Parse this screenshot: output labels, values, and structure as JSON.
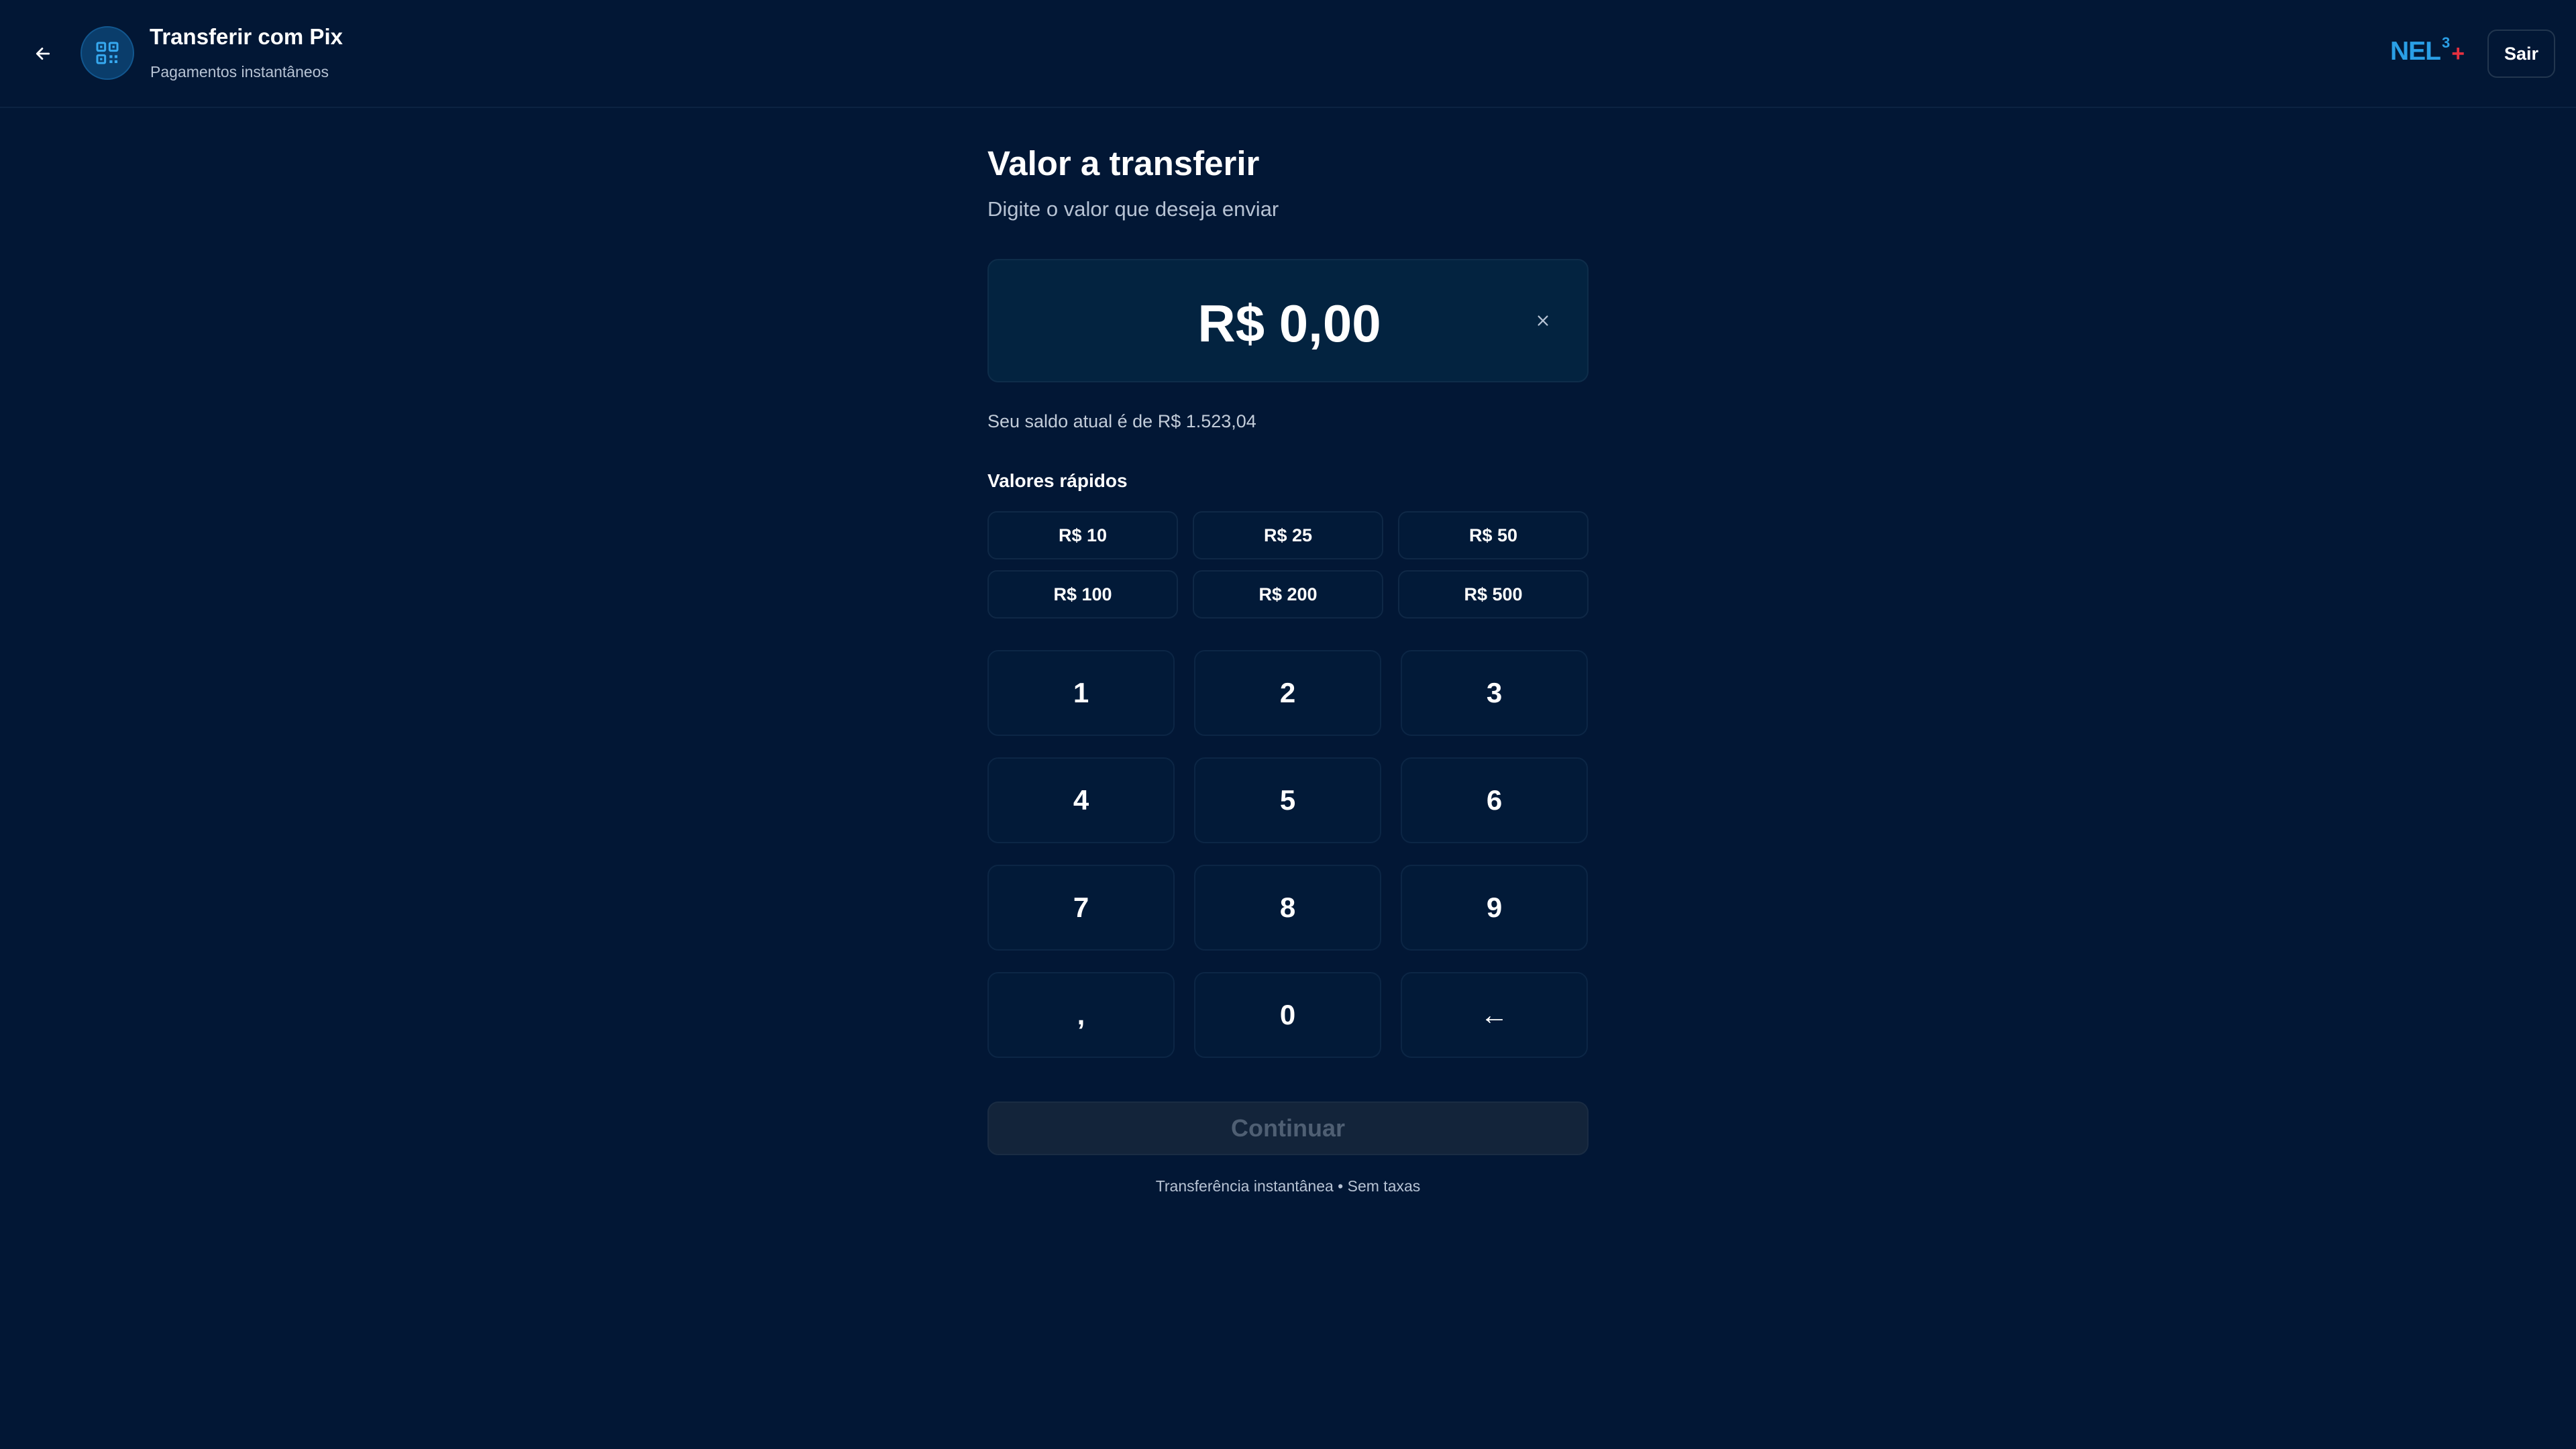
{
  "header": {
    "title": "Transferir com Pix",
    "subtitle": "Pagamentos instantâneos",
    "back_icon": "arrow-left-icon",
    "app_icon": "qr-code-icon",
    "brand": {
      "name": "NEL",
      "superscript": "3",
      "plus": "+"
    },
    "logout_label": "Sair"
  },
  "main": {
    "title": "Valor a transferir",
    "subtitle": "Digite o valor que deseja enviar",
    "amount": "R$ 0,00",
    "clear_icon": "close-icon",
    "balance_text": "Seu saldo atual é de R$ 1.523,04",
    "quick_label": "Valores rápidos",
    "quick_values": [
      "R$ 10",
      "R$ 25",
      "R$ 50",
      "R$ 100",
      "R$ 200",
      "R$ 500"
    ],
    "keypad": [
      "1",
      "2",
      "3",
      "4",
      "5",
      "6",
      "7",
      "8",
      "9",
      ",",
      "0",
      "←"
    ],
    "continue_label": "Continuar",
    "footer_note": "Transferência instantânea • Sem taxas"
  },
  "colors": {
    "background": "#021735",
    "brand_blue": "#2a9fe6",
    "brand_red": "#e5303f",
    "disabled_button": "#13243a"
  }
}
